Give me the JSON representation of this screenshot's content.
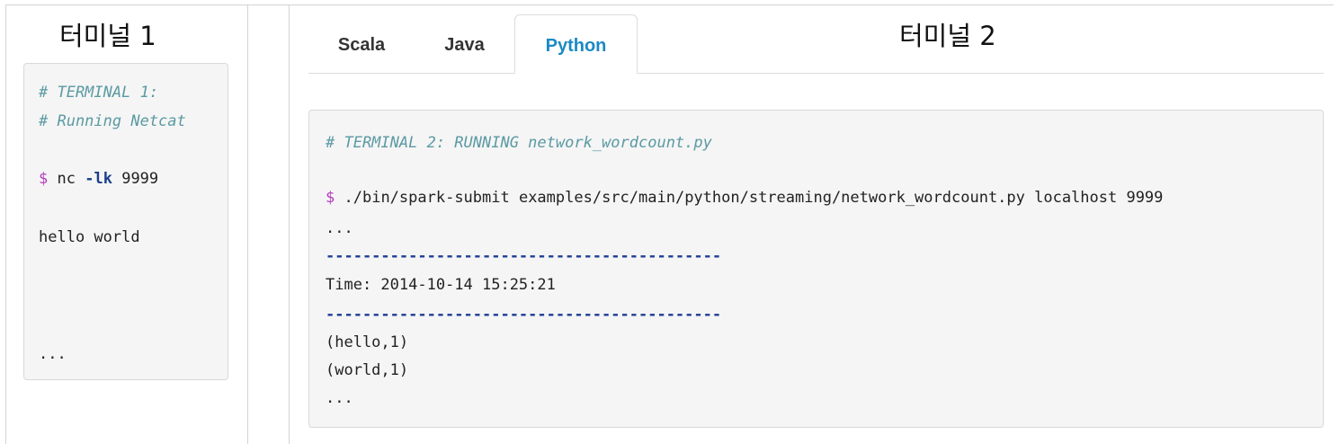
{
  "terminal1": {
    "title": "터미널 1",
    "lines": [
      "# TERMINAL 1:",
      "# Running Netcat",
      "$",
      "nc",
      "-lk",
      "9999",
      "hello world",
      "..."
    ]
  },
  "terminal2": {
    "title": "터미널 2",
    "tabs": [
      "Scala",
      "Java",
      "Python"
    ],
    "active_tab": "Python",
    "comment": "# TERMINAL 2: RUNNING network_wordcount.py",
    "prompt": "$",
    "command": "./bin/spark-submit examples/src/main/python/streaming/network_wordcount.py localhost 9999",
    "ellipsis1": "...",
    "separator": "-------------------------------------------",
    "time_line": "Time: 2014-10-14 15:25:21",
    "output": [
      "(hello,1)",
      "(world,1)"
    ],
    "ellipsis2": "..."
  },
  "colors": {
    "comment": "#5b9aa3",
    "prompt": "#b53bbd",
    "keyword": "#1a3e8c",
    "separator": "#1f3f95",
    "active_tab": "#1b8ac4",
    "code_background": "#f5f5f5"
  }
}
